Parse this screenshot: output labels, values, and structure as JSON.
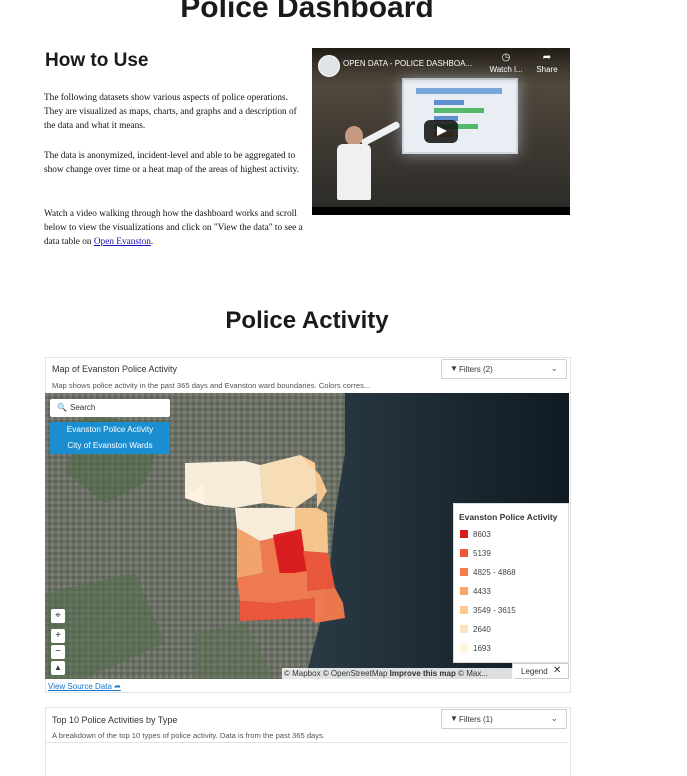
{
  "page": {
    "title": "Police Dashboard",
    "howto": {
      "heading": "How to Use",
      "para1": "The following datasets show various aspects of police operations.  They are visualized as maps, charts, and graphs and a description of the data  and what it means.",
      "para2": "The data is anonymized, incident-level and able to be aggregated to show change over time or a heat map of the areas of highest activity.",
      "para3_before": "Watch a video walking through how the dashboard works and scroll below to view the visualizations and click on \"View the data\" to see a data table on ",
      "para3_link": "Open Evanston",
      "para3_after": "."
    },
    "video": {
      "title": "OPEN DATA - POLICE DASHBOA...",
      "watch_label": "Watch l...",
      "share_label": "Share"
    },
    "section_title": "Police Activity"
  },
  "map_widget": {
    "title": "Map of Evanston Police Activity",
    "subtitle": "Map shows police activity in the past 365 days and Evanston ward boundaries. Colors corres...",
    "filter_label": "Filters (2)",
    "search_placeholder": "Search",
    "layers": [
      "Evanston Police Activity",
      "City of Evanston Wards"
    ],
    "legend": {
      "title": "Evanston Police Activity",
      "items": [
        {
          "label": "8603",
          "color": "#d7191c"
        },
        {
          "label": "5139",
          "color": "#f0553a"
        },
        {
          "label": "4825 - 4868",
          "color": "#f57a4e"
        },
        {
          "label": "4433",
          "color": "#f9a66c"
        },
        {
          "label": "3549 - 3615",
          "color": "#fcc98f"
        },
        {
          "label": "2640",
          "color": "#fde3bc"
        },
        {
          "label": "1693",
          "color": "#fff3e0"
        }
      ],
      "toggle_label": "Legend"
    },
    "zoom": {
      "in": "+",
      "out": "−"
    },
    "attribution": {
      "mapbox": "© Mapbox",
      "osm": "© OpenStreetMap",
      "improve": "Improve this map",
      "maxar": "© Max..."
    },
    "source_link": "View Source Data"
  },
  "chart_widget": {
    "title": "Top 10 Police Activities by Type",
    "subtitle": "A breakdown of the top 10 types of police activity. Data is from the past 365 days.",
    "filter_label": "Filters (1)"
  },
  "icons": {
    "search": "search-icon",
    "filter": "filter-icon",
    "chevron": "chevron-down-icon",
    "locate": "locate-icon",
    "close": "close-icon",
    "share": "share-icon",
    "clock": "clock-icon",
    "play": "play-icon",
    "external": "external-link-icon"
  }
}
